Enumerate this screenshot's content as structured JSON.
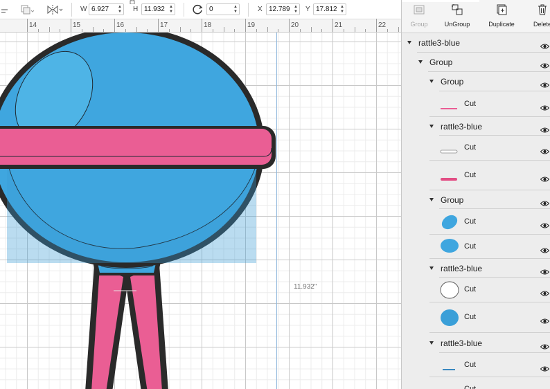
{
  "toolbar": {
    "width_label": "W",
    "width_value": "6.927",
    "height_label": "H",
    "height_value": "11.932",
    "rotate_value": "0",
    "x_label": "X",
    "x_value": "12.789",
    "y_label": "Y",
    "y_value": "17.812",
    "icons": [
      "align-icon",
      "arrange-icon",
      "flip-icon",
      "lock-icon",
      "rotate-icon"
    ]
  },
  "ruler": {
    "labels": [
      "14",
      "15",
      "16",
      "17",
      "18",
      "19",
      "20",
      "21",
      "22"
    ]
  },
  "canvas": {
    "dimension_label": "11.932\"",
    "colors": {
      "blue": "#3fa6df",
      "pink": "#ea5e94",
      "outline": "#2a2a2a",
      "guide": "#8fb7dc"
    }
  },
  "panel": {
    "buttons": [
      {
        "label": "Group",
        "icon": "group-icon",
        "enabled": false
      },
      {
        "label": "UnGroup",
        "icon": "ungroup-icon",
        "enabled": true
      },
      {
        "label": "Duplicate",
        "icon": "duplicate-icon",
        "enabled": true
      },
      {
        "label": "Delete",
        "icon": "trash-icon",
        "enabled": true
      }
    ],
    "layers": [
      {
        "type": "group",
        "name": "rattle3-blue",
        "level": 0
      },
      {
        "type": "group",
        "name": "Group",
        "level": 1
      },
      {
        "type": "group",
        "name": "Group",
        "level": 2
      },
      {
        "type": "item",
        "name": "Cut",
        "thumb": "pink-line"
      },
      {
        "type": "group",
        "name": "rattle3-blue",
        "level": 2
      },
      {
        "type": "item",
        "name": "Cut",
        "thumb": "white-bar"
      },
      {
        "type": "item",
        "name": "Cut",
        "thumb": "pink-bar"
      },
      {
        "type": "group",
        "name": "Group",
        "level": 2
      },
      {
        "type": "item",
        "name": "Cut",
        "thumb": "blue-ellipse"
      },
      {
        "type": "item",
        "name": "Cut",
        "thumb": "blue-oval"
      },
      {
        "type": "group",
        "name": "rattle3-blue",
        "level": 2
      },
      {
        "type": "item",
        "name": "Cut",
        "thumb": "white-circle"
      },
      {
        "type": "item",
        "name": "Cut",
        "thumb": "blue-circle"
      },
      {
        "type": "group",
        "name": "rattle3-blue",
        "level": 2
      },
      {
        "type": "item",
        "name": "Cut",
        "thumb": "blue-line"
      },
      {
        "type": "item",
        "name": "Cut",
        "thumb": "blue-rect"
      }
    ]
  }
}
